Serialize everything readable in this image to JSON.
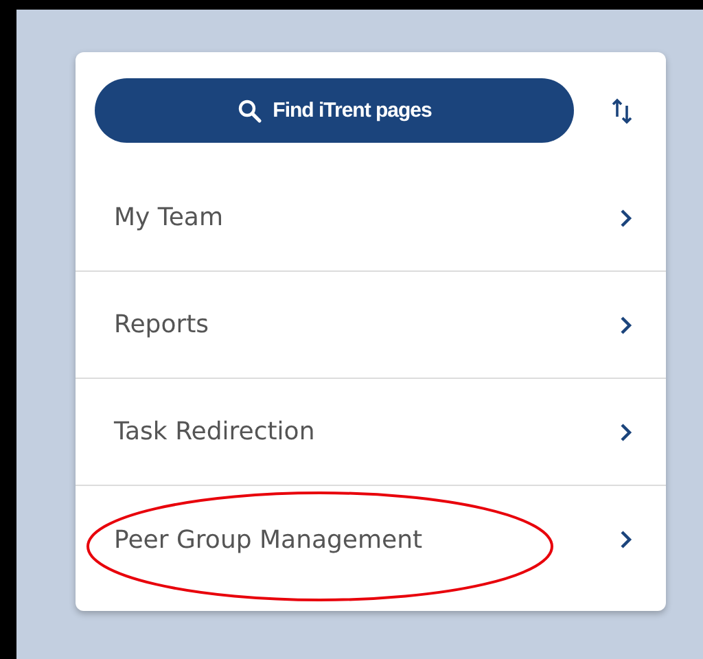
{
  "search_button": {
    "label": "Find iTrent pages"
  },
  "menu_items": [
    {
      "label": "My Team",
      "circled": false
    },
    {
      "label": "Reports",
      "circled": false
    },
    {
      "label": "Task Redirection",
      "circled": false
    },
    {
      "label": "Peer Group Management",
      "circled": true
    }
  ]
}
